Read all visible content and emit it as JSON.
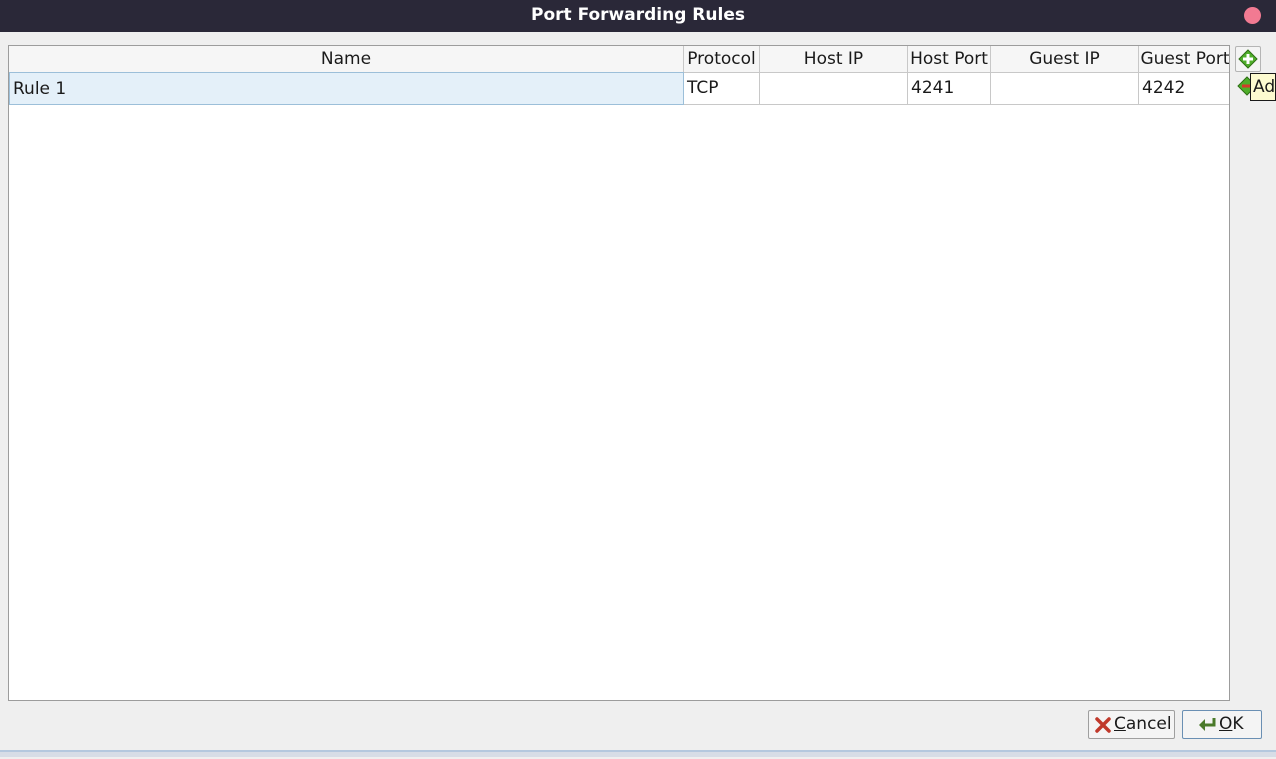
{
  "window": {
    "title": "Port Forwarding Rules"
  },
  "table": {
    "columns": [
      "Name",
      "Protocol",
      "Host IP",
      "Host Port",
      "Guest IP",
      "Guest Port"
    ],
    "rows": [
      {
        "name": "Rule 1",
        "protocol": "TCP",
        "host_ip": "",
        "host_port": "4241",
        "guest_ip": "",
        "guest_port": "4242"
      }
    ]
  },
  "side_buttons": {
    "add_icon": "add-rule-icon",
    "remove_icon": "remove-rule-icon"
  },
  "tooltip": {
    "text": "Ad"
  },
  "buttons": {
    "cancel_label": "Cancel",
    "ok_label": "OK"
  },
  "colors": {
    "titlebar": "#2a2838",
    "close": "#f27a92",
    "selection": "#e4f0f9",
    "add_green": "#4fae2a",
    "cancel_red": "#c0392b"
  }
}
